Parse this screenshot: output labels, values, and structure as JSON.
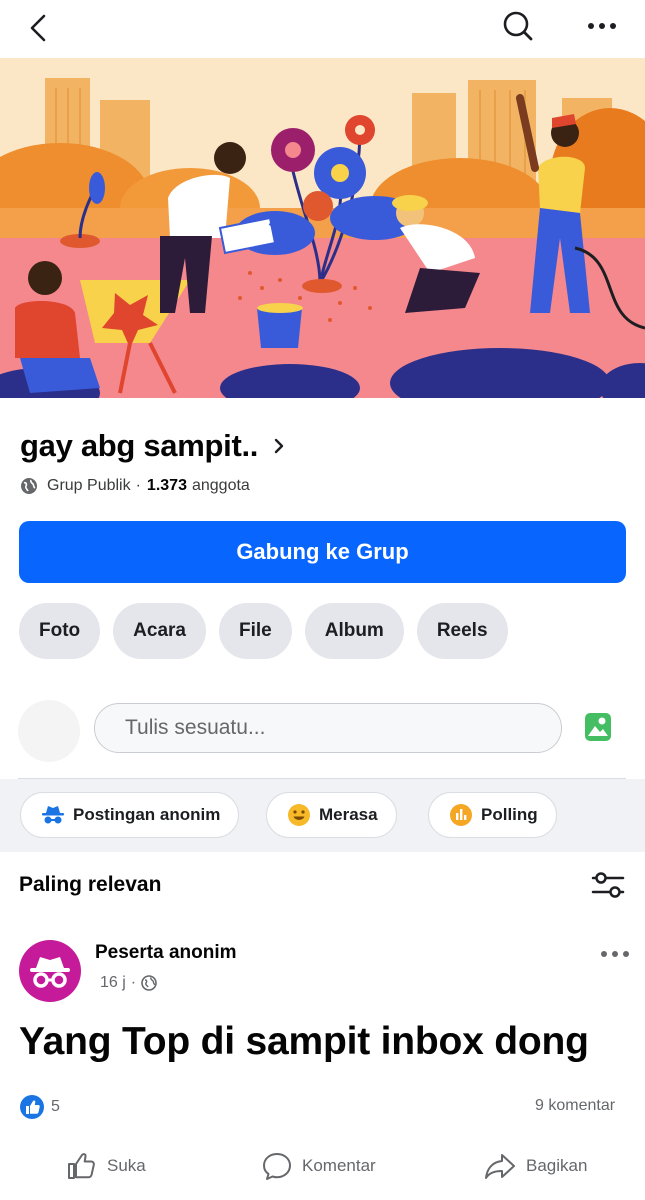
{
  "topbar": {
    "back_icon": "chevron-left-icon",
    "search_icon": "search-icon",
    "more_icon": "more-horizontal-icon"
  },
  "group": {
    "name": "gay abg sampit..",
    "privacy": "Grup Publik",
    "separator": "·",
    "member_count": "1.373",
    "member_label": "anggota"
  },
  "join_button": "Gabung ke Grup",
  "chips": [
    "Foto",
    "Acara",
    "File",
    "Album",
    "Reels"
  ],
  "composer": {
    "placeholder": "Tulis sesuatu..."
  },
  "post_actions": [
    {
      "label": "Postingan anonim",
      "icon": "incognito-icon"
    },
    {
      "label": "Merasa",
      "icon": "smile-icon"
    },
    {
      "label": "Polling",
      "icon": "poll-icon"
    }
  ],
  "sort": {
    "label": "Paling relevan"
  },
  "post": {
    "author": "Peserta anonim",
    "time": "16 j",
    "time_separator": "·",
    "text": "Yang Top di sampit inbox dong",
    "likes": "5",
    "comments": "9 komentar"
  },
  "footer_actions": {
    "like": "Suka",
    "comment": "Komentar",
    "share": "Bagikan"
  },
  "colors": {
    "brand_blue": "#0866ff",
    "anon_avatar": "#c51a9a",
    "photo_green": "#45bd62",
    "emoji_yellow": "#f7b928",
    "poll_orange": "#f5a623"
  }
}
